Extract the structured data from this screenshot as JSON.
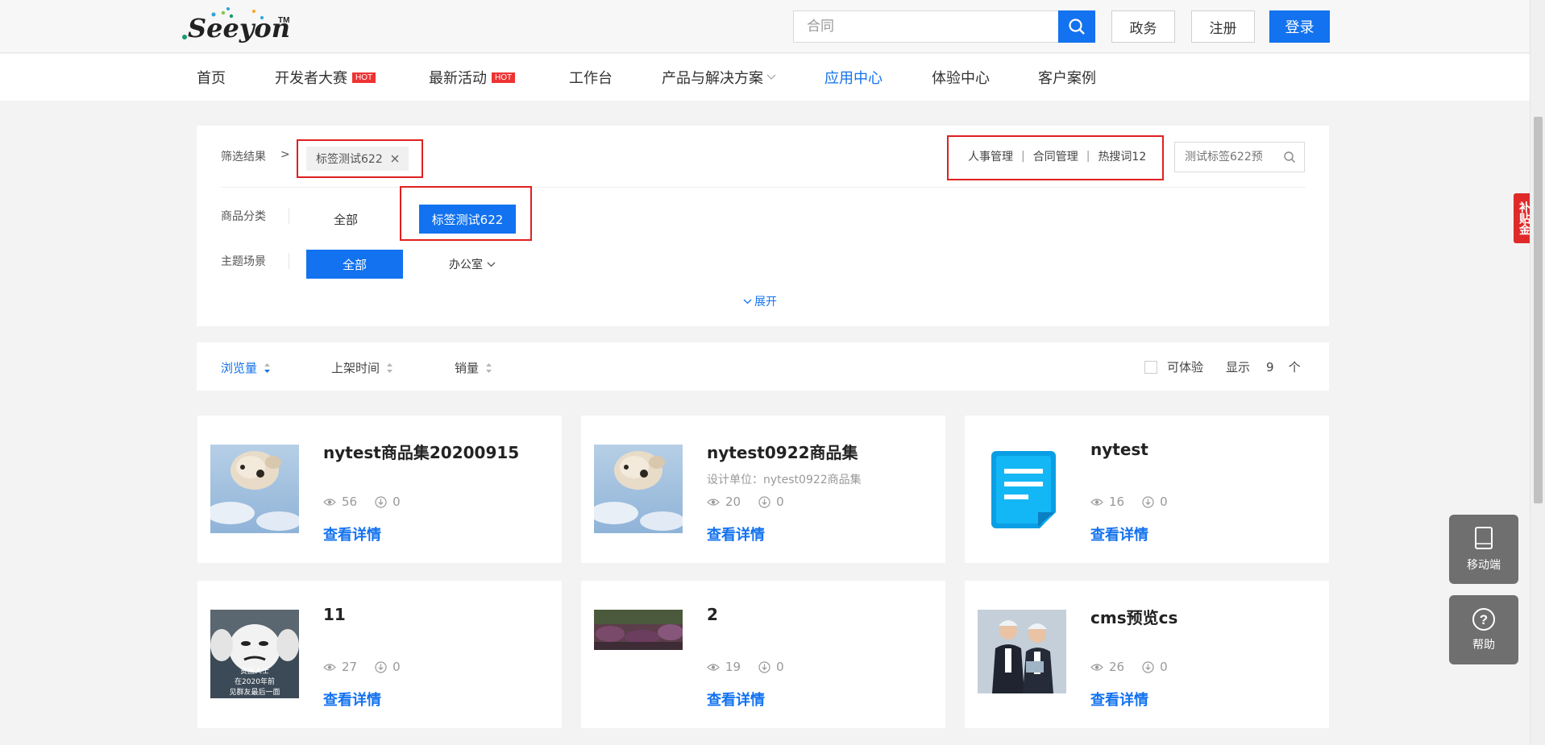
{
  "header": {
    "logo_text": "Seeyon",
    "logo_tm": "TM",
    "search_placeholder": "合同",
    "btn_gov": "政务",
    "btn_register": "注册",
    "btn_login": "登录"
  },
  "nav": {
    "items": [
      {
        "label": "首页",
        "hot": ""
      },
      {
        "label": "开发者大赛",
        "hot": "HOT"
      },
      {
        "label": "最新活动",
        "hot": "HOT"
      },
      {
        "label": "工作台",
        "hot": ""
      },
      {
        "label": "产品与解决方案",
        "hot": ""
      },
      {
        "label": "应用中心",
        "hot": ""
      },
      {
        "label": "体验中心",
        "hot": ""
      },
      {
        "label": "客户案例",
        "hot": ""
      }
    ]
  },
  "filter": {
    "result_label": "筛选结果",
    "separator": ">",
    "active_tag": "标签测试622",
    "hot_words": [
      "人事管理",
      "合同管理",
      "热搜词12"
    ],
    "search_placeholder": "测试标签622预",
    "category_label": "商品分类",
    "category_all": "全部",
    "category_selected": "标签测试622",
    "scene_label": "主题场景",
    "scene_all": "全部",
    "scene_office": "办公室",
    "expand": "展开"
  },
  "sort": {
    "views": "浏览量",
    "listed": "上架时间",
    "sales": "销量",
    "experience": "可体验",
    "display": "显示",
    "count": "9",
    "unit": "个"
  },
  "cards": [
    {
      "title": "nytest商品集20200915",
      "subtitle": "",
      "views": "56",
      "downloads": "0",
      "detail": "查看详情"
    },
    {
      "title": "nytest0922商品集",
      "subtitle": "设计单位：nytest0922商品集",
      "views": "20",
      "downloads": "0",
      "detail": "查看详情"
    },
    {
      "title": "nytest",
      "subtitle": "",
      "views": "16",
      "downloads": "0",
      "detail": "查看详情"
    },
    {
      "title": "11",
      "subtitle": "",
      "views": "27",
      "downloads": "0",
      "detail": "查看详情"
    },
    {
      "title": "2",
      "subtitle": "",
      "views": "19",
      "downloads": "0",
      "detail": "查看详情"
    },
    {
      "title": "cms预览cs",
      "subtitle": "",
      "views": "26",
      "downloads": "0",
      "detail": "查看详情"
    }
  ],
  "meme_text": [
    "贫困人士",
    "在2020年前",
    "见群友最后一面"
  ],
  "side": {
    "subsidy": "补贴金",
    "mobile": "移动端",
    "help": "帮助"
  },
  "colors": {
    "accent": "#1272ef",
    "hot": "#e33333",
    "highlight_box": "#e02020"
  }
}
